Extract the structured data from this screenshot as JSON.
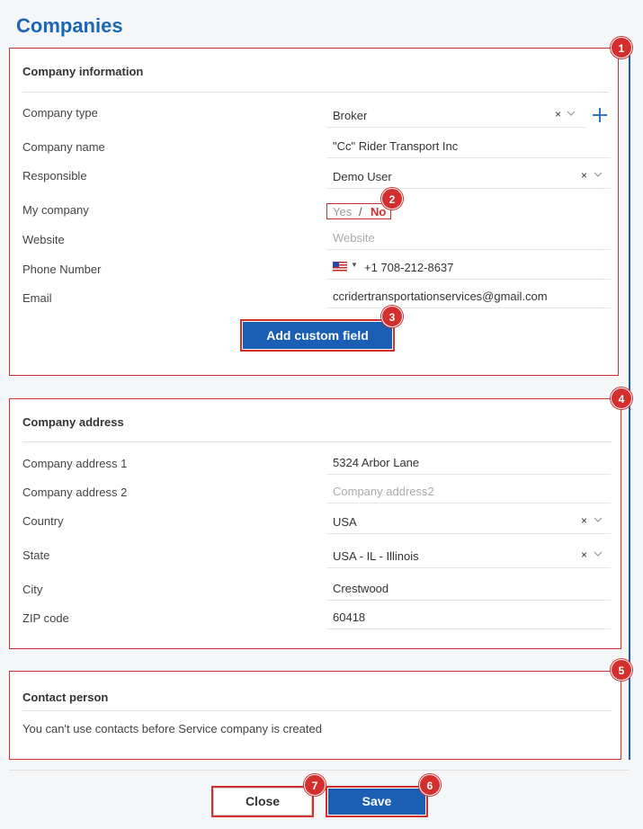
{
  "page": {
    "title": "Companies"
  },
  "company_info": {
    "title": "Company information",
    "fields": {
      "company_type": {
        "label": "Company type",
        "value": "Broker"
      },
      "company_name": {
        "label": "Company name",
        "value": "\"Cc\" Rider Transport Inc"
      },
      "responsible": {
        "label": "Responsible",
        "value": "Demo User"
      },
      "my_company": {
        "label": "My company",
        "yes": "Yes",
        "separator": "/",
        "no": "No",
        "selected": "No"
      },
      "website": {
        "label": "Website",
        "value": "",
        "placeholder": "Website"
      },
      "phone": {
        "label": "Phone Number",
        "country": "US",
        "value": "+1 708-212-8637"
      },
      "email": {
        "label": "Email",
        "value": "ccridertransportationservices@gmail.com"
      }
    },
    "add_custom_field": "Add custom field"
  },
  "company_address": {
    "title": "Company address",
    "fields": {
      "address1": {
        "label": "Company address 1",
        "value": "5324 Arbor Lane"
      },
      "address2": {
        "label": "Company address 2",
        "value": "",
        "placeholder": "Company address2"
      },
      "country": {
        "label": "Country",
        "value": "USA"
      },
      "state": {
        "label": "State",
        "value": "USA - IL - Illinois"
      },
      "city": {
        "label": "City",
        "value": "Crestwood"
      },
      "zip": {
        "label": "ZIP code",
        "value": "60418"
      }
    }
  },
  "contact_person": {
    "title": "Contact person",
    "message": "You can't use contacts before Service company is created"
  },
  "footer": {
    "close": "Close",
    "save": "Save"
  },
  "badges": [
    "1",
    "2",
    "3",
    "4",
    "5",
    "6",
    "7"
  ],
  "icons": {
    "clear": "×",
    "chevron": "chevron-down-icon",
    "plus": "plus-icon",
    "flag": "us-flag-icon"
  },
  "colors": {
    "accent": "#1a66b8",
    "button": "#1a5fb4",
    "highlight": "#d32f2f"
  }
}
